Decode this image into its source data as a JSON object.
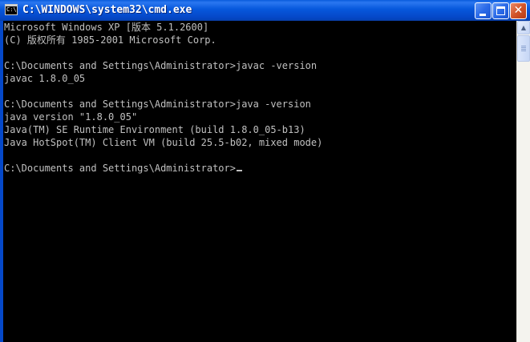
{
  "window": {
    "title": "C:\\WINDOWS\\system32\\cmd.exe",
    "icon": "cmd-window-icon",
    "icon_text": "C:\\"
  },
  "titlebar_buttons": {
    "minimize_icon": "minimize-icon",
    "maximize_icon": "maximize-icon",
    "close_icon": "close-icon",
    "close_glyph": "✕"
  },
  "console": {
    "lines": [
      "Microsoft Windows XP [版本 5.1.2600]",
      "(C) 版权所有 1985-2001 Microsoft Corp.",
      "",
      "C:\\Documents and Settings\\Administrator>javac -version",
      "javac 1.8.0_05",
      "",
      "C:\\Documents and Settings\\Administrator>java -version",
      "java version \"1.8.0_05\"",
      "Java(TM) SE Runtime Environment (build 1.8.0_05-b13)",
      "Java HotSpot(TM) Client VM (build 25.5-b02, mixed mode)",
      "",
      "C:\\Documents and Settings\\Administrator>"
    ],
    "text_color": "#c0c0c0",
    "background_color": "#000000"
  },
  "scrollbar": {
    "up_arrow_glyph": "▲",
    "up_arrow_icon": "scroll-up-arrow-icon"
  },
  "colors": {
    "titlebar_blue": "#0758dc",
    "close_red": "#d2552a"
  }
}
